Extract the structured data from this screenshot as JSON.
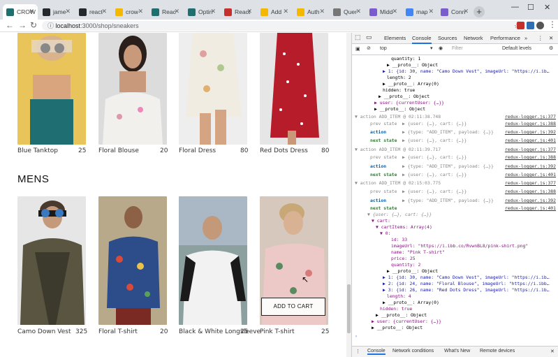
{
  "browser": {
    "tabs": [
      {
        "label": "CROW",
        "color": "#1f6f6f"
      },
      {
        "label": "jame",
        "color": "#24292e"
      },
      {
        "label": "react",
        "color": "#24292e"
      },
      {
        "label": "crow",
        "color": "#f5b800"
      },
      {
        "label": "Reac",
        "color": "#1f6f6f"
      },
      {
        "label": "Optin",
        "color": "#1f6f6f"
      },
      {
        "label": "React",
        "color": "#c4302b"
      },
      {
        "label": "Add",
        "color": "#f5b800"
      },
      {
        "label": "Auth",
        "color": "#f5b800"
      },
      {
        "label": "Quer",
        "color": "#777777"
      },
      {
        "label": "Midd",
        "color": "#7b5ccf"
      },
      {
        "label": "map",
        "color": "#4285f4"
      },
      {
        "label": "Conn",
        "color": "#7b5ccf"
      }
    ],
    "url_host": "localhost",
    "url_path": ":3000/shop/sneakers"
  },
  "shop": {
    "womens": [
      {
        "name": "Blue Tanktop",
        "price": "25"
      },
      {
        "name": "Floral Blouse",
        "price": "20"
      },
      {
        "name": "Floral Dress",
        "price": "80"
      },
      {
        "name": "Red Dots Dress",
        "price": "80"
      }
    ],
    "mens_title": "MENS",
    "mens": [
      {
        "name": "Camo Down Vest",
        "price": "325"
      },
      {
        "name": "Floral T-shirt",
        "price": "20"
      },
      {
        "name": "Black & White Longsleeve",
        "price": "25"
      },
      {
        "name": "Pink T-shirt",
        "price": "25"
      }
    ],
    "add_to_cart": "ADD TO CART"
  },
  "devtools": {
    "tabs": [
      "Elements",
      "Console",
      "Sources",
      "Network",
      "Performance",
      "»"
    ],
    "context": "top",
    "filter_placeholder": "Filter",
    "levels": "Default levels",
    "src_377": "redux-logger.js:377",
    "src_388": "redux-logger.js:388",
    "src_392": "redux-logger.js:392",
    "src_401": "redux-logger.js:401",
    "top_quantity": "quantity: 1",
    "top_proto": "▶ __proto__: Object",
    "top_item1": "▶ 1: {id: 30, name: \"Camo Down Vest\", imageUrl: \"https://i.ib…",
    "top_length": "length: 2",
    "top_proto_arr": "▶ __proto__: Array(0)",
    "top_hidden": "hidden: true",
    "top_proto2": "▶ __proto__: Object",
    "top_user": "▶ user: {currentUser: {…}}",
    "top_proto3": "▶ __proto__: Object",
    "a1": "▼ action ADD_ITEM @ 02:11:38.748",
    "a2": "▼ action ADD_ITEM @ 02:11:39.717",
    "a3": "▼ action ADD_ITEM @ 02:15:03.775",
    "prev": "prev state",
    "act": "action",
    "next": "next state",
    "prev_val": "▶ {user: {…}, cart: {…}}",
    "act_val": "▶ {type: \"ADD_ITEM\", payload: {…}}",
    "next_val": "▶ {user: {…}, cart: {…}}",
    "exp_obj": "▼ {user: {…}, cart: {…}}",
    "cart": "▼ cart:",
    "cartItems": "▼ cartItems: Array(4)",
    "zero": "▼ 0:",
    "id": "id: 33",
    "imageUrl": "imageUrl: \"https://i.ibb.co/RvwnBL8/pink-shirt.png\"",
    "name": "name: \"Pink T-shirt\"",
    "price": "price: 25",
    "quantity": "quantity: 2",
    "proto_o": "▶ __proto__: Object",
    "i1": "▶ 1: {id: 30, name: \"Camo Down Vest\", imageUrl: \"https://i.ib…",
    "i2": "▶ 2: {id: 24, name: \"Floral Blouse\", imageUrl: \"https://i.ibb…",
    "i3": "▶ 3: {id: 26, name: \"Red Dots Dress\", imageUrl: \"https://i.ib…",
    "len4": "length: 4",
    "proto_a": "▶ __proto__: Array(0)",
    "hidden": "hidden: true",
    "proto_o2": "▶ __proto__: Object",
    "user": "▶ user: {currentUser: {…}}",
    "proto_o3": "▶ __proto__: Object",
    "drawer_tabs": [
      "Console",
      "Network conditions",
      "What's New",
      "Remote devices"
    ]
  }
}
